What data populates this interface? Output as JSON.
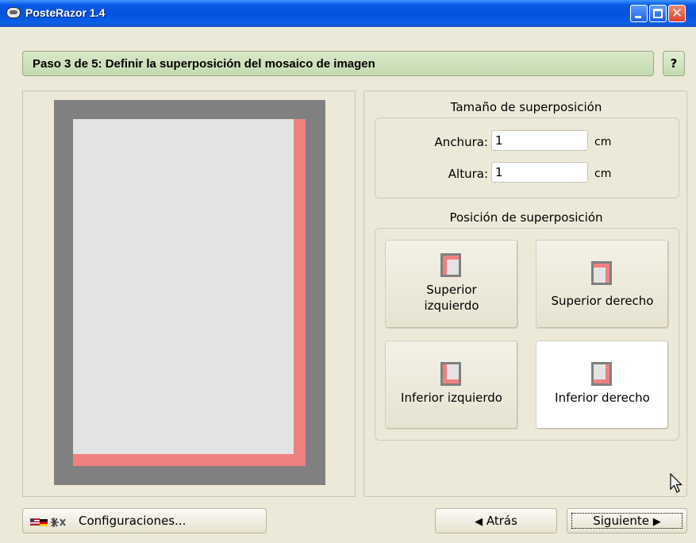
{
  "window": {
    "title": "PosteRazor 1.4"
  },
  "step_header": {
    "text": "Paso 3 de 5: Definir la superposición del mosaico de imagen",
    "help_label": "?"
  },
  "overlap_size": {
    "section_label": "Tamaño de superposición",
    "width_label": "Anchura:",
    "width_value": "1",
    "height_label": "Altura:",
    "height_value": "1",
    "unit": "cm"
  },
  "overlap_position": {
    "section_label": "Posición de superposición",
    "top_left_line1": "Superior",
    "top_left_line2": "izquierdo",
    "top_right": "Superior derecho",
    "bottom_left": "Inferior izquierdo",
    "bottom_right": "Inferior derecho",
    "selected": "Inferior derecho"
  },
  "footer": {
    "settings_label": "Configuraciones...",
    "back_label": "Atrás",
    "next_label": "Siguiente"
  },
  "colors": {
    "overlap": "#f08080",
    "tile_border": "#808080",
    "tile_fill": "#e3e3e3",
    "header": "#c4dab0"
  },
  "icons": [
    "app-icon",
    "minimize-icon",
    "maximize-icon",
    "close-icon",
    "help-icon",
    "flags-icon",
    "arrow-left-icon",
    "arrow-right-icon",
    "mouse-cursor-icon"
  ]
}
